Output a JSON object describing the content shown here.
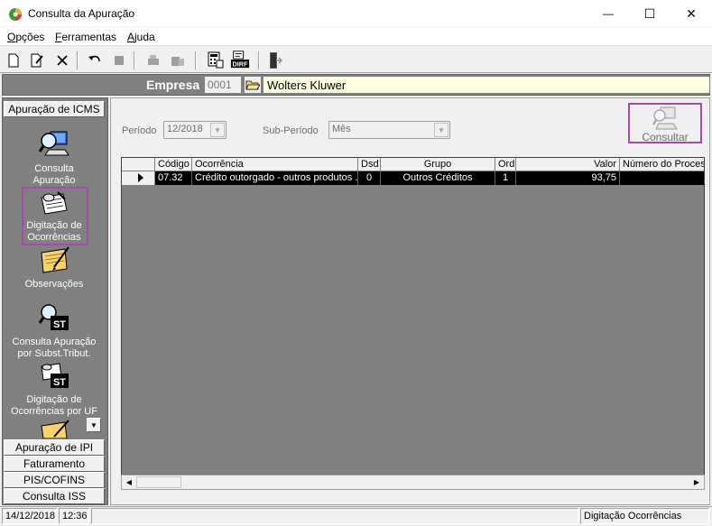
{
  "window": {
    "title": "Consulta da Apuração",
    "minimize_glyph": "—",
    "maximize_glyph": "☐",
    "close_glyph": "✕"
  },
  "menu": [
    {
      "first": "O",
      "rest": "pções"
    },
    {
      "first": "F",
      "rest": "erramentas"
    },
    {
      "first": "A",
      "rest": "juda"
    }
  ],
  "empresa": {
    "label": "Empresa",
    "code": "0001",
    "name": "Wolters Kluwer"
  },
  "sidebar": {
    "header_active": "Apuração de ICMS",
    "items": [
      {
        "label_line1": "Consulta",
        "label_line2": "Apuração"
      },
      {
        "label_line1": "Digitação de",
        "label_line2": "Ocorrências"
      },
      {
        "label_line1": "Observações",
        "label_line2": ""
      },
      {
        "label_line1": "Consulta  Apuração",
        "label_line2": "por Subst.Tribut."
      },
      {
        "label_line1": "Digitação de",
        "label_line2": "Ocorrências por UF"
      }
    ],
    "headers_bottom": [
      "Apuração de IPI",
      "Faturamento",
      "PIS/COFINS",
      "Consulta ISS"
    ]
  },
  "filters": {
    "periodo_label": "Período",
    "periodo_value": "12/2018",
    "subperiodo_label": "Sub-Período",
    "subperiodo_value": "Mês",
    "consultar_label": "Consultar"
  },
  "grid": {
    "columns": [
      "Código",
      "Ocorrência",
      "Dsd",
      "Grupo",
      "Ord",
      "Valor",
      "Número do Process"
    ],
    "rows": [
      [
        "07.32",
        "Crédito outorgado - outros produtos ...",
        "0",
        "Outros Créditos",
        "1",
        "93,75",
        ""
      ]
    ]
  },
  "status": {
    "date": "14/12/2018",
    "time": "12:36",
    "message": "Digitação Ocorrências"
  },
  "colors": {
    "highlight": "#a64ca6",
    "selected_row_bg": "#000000",
    "empresa_name_bg": "#ffffe1"
  }
}
